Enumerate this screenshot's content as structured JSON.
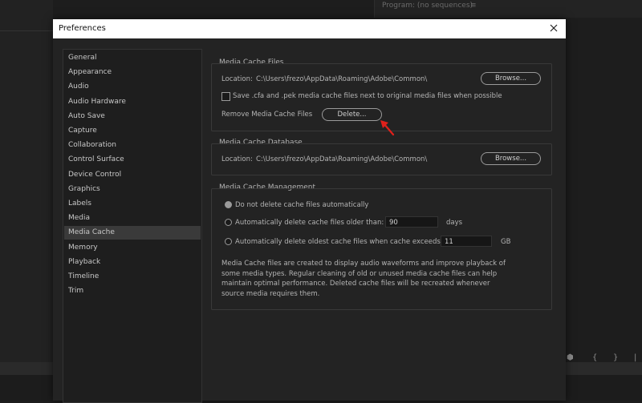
{
  "background": {
    "program_label": "Program: (no sequences)",
    "hamburger_icon": "menu-icon"
  },
  "dialog": {
    "title": "Preferences",
    "close_icon": "close-icon"
  },
  "nav": {
    "items": [
      "General",
      "Appearance",
      "Audio",
      "Audio Hardware",
      "Auto Save",
      "Capture",
      "Collaboration",
      "Control Surface",
      "Device Control",
      "Graphics",
      "Labels",
      "Media",
      "Media Cache",
      "Memory",
      "Playback",
      "Timeline",
      "Trim"
    ],
    "selected": "Media Cache"
  },
  "media_cache_files": {
    "title": "Media Cache Files",
    "location_label": "Location:",
    "location_path": "C:\\Users\\frezo\\AppData\\Roaming\\Adobe\\Common\\",
    "browse_label": "Browse...",
    "save_checkbox_label": "Save .cfa and .pek media cache files next to original media files when possible",
    "save_checked": false,
    "remove_label": "Remove Media Cache Files",
    "delete_label": "Delete..."
  },
  "media_cache_database": {
    "title": "Media Cache Database",
    "location_label": "Location:",
    "location_path": "C:\\Users\\frezo\\AppData\\Roaming\\Adobe\\Common\\",
    "browse_label": "Browse..."
  },
  "media_cache_management": {
    "title": "Media Cache Management",
    "option_no_delete": "Do not delete cache files automatically",
    "option_older_than": "Automatically delete cache files older than:",
    "days_value": "90",
    "days_unit": "days",
    "option_exceeds": "Automatically delete oldest cache files when cache exceeds:",
    "gb_value": "11",
    "gb_unit": "GB",
    "selected_option": "no_delete",
    "description": "Media Cache files are created to display audio waveforms and improve playback of some media types.  Regular cleaning of old or unused media cache files can help maintain optimal performance. Deleted cache files will be recreated whenever source media requires them."
  },
  "colors": {
    "annotation_arrow": "#e0201b",
    "dialog_bg": "#232323",
    "selected_nav": "#3a3a3a"
  }
}
